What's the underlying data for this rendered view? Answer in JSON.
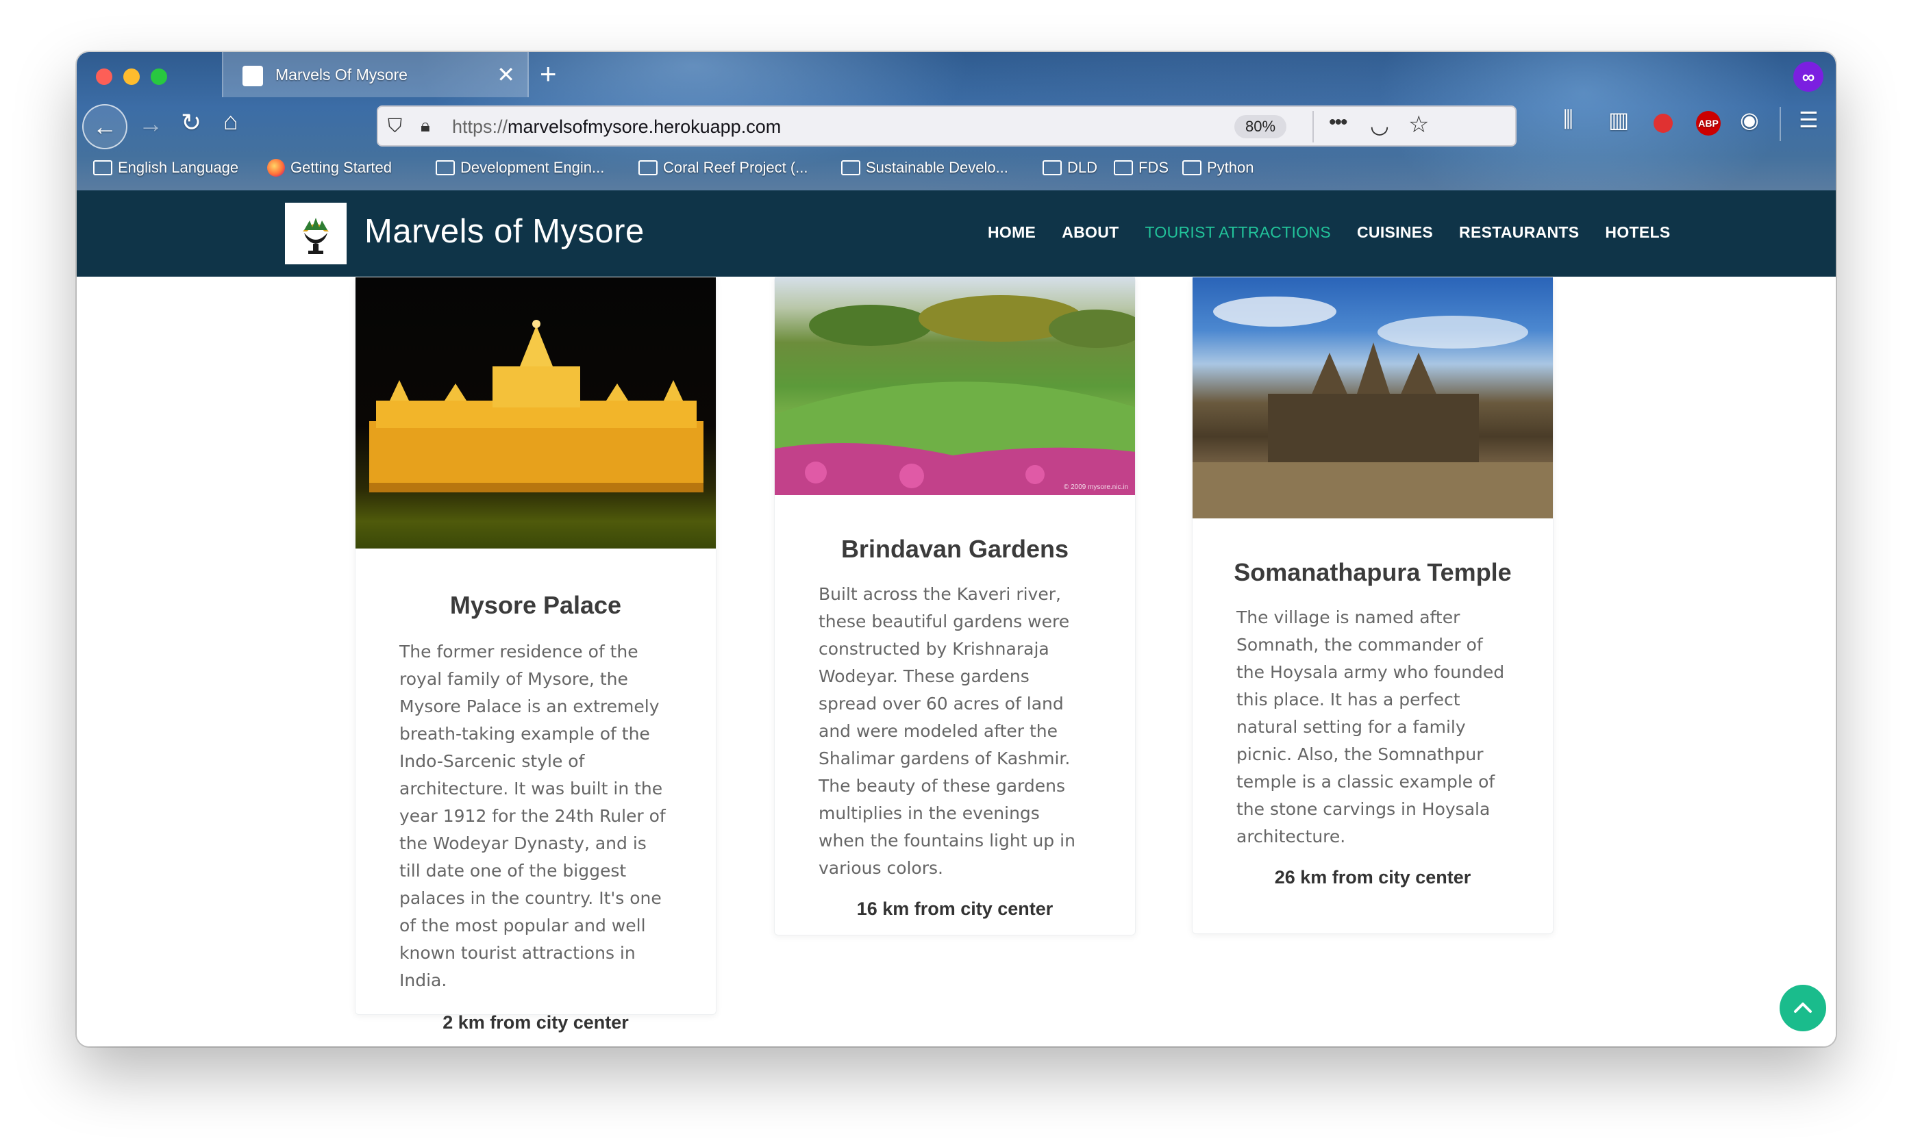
{
  "browser": {
    "tab_title": "Marvels Of Mysore",
    "tab_close": "✕",
    "new_tab": "+",
    "url_protocol": "https://",
    "url_host": "marvelsofmysore.herokuapp.com",
    "zoom": "80%",
    "more_icon": "•••",
    "abp_label": "ABP",
    "bookmarks": [
      {
        "label": "English Language",
        "icon": "folder-icon"
      },
      {
        "label": "Getting Started",
        "icon": "firefox-icon"
      },
      {
        "label": "Development Engin...",
        "icon": "folder-icon"
      },
      {
        "label": "Coral Reef Project (...",
        "icon": "folder-icon"
      },
      {
        "label": "Sustainable Develo...",
        "icon": "folder-icon"
      },
      {
        "label": "DLD",
        "icon": "folder-icon"
      },
      {
        "label": "FDS",
        "icon": "folder-icon"
      },
      {
        "label": "Python",
        "icon": "folder-icon"
      }
    ]
  },
  "site": {
    "title": "Marvels of Mysore",
    "nav": [
      {
        "label": "HOME",
        "active": false
      },
      {
        "label": "ABOUT",
        "active": false
      },
      {
        "label": "TOURIST ATTRACTIONS",
        "active": true
      },
      {
        "label": "CUISINES",
        "active": false
      },
      {
        "label": "RESTAURANTS",
        "active": false
      },
      {
        "label": "HOTELS",
        "active": false
      }
    ],
    "accent_color": "#22c39a",
    "header_color": "#0f3448"
  },
  "cards": [
    {
      "title": "Mysore Palace",
      "description": "The former residence of the royal family of Mysore, the Mysore Palace is an extremely breath-taking example of the Indo-Sarcenic style of architecture. It was built in the year 1912 for the 24th Ruler of the Wodeyar Dynasty, and is till date one of the biggest palaces in the country. It's one of the most popular and well known tourist attractions in India.",
      "distance": "2 km from city center"
    },
    {
      "title": "Brindavan Gardens",
      "description": "Built across the Kaveri river, these beautiful gardens were constructed by Krishnaraja Wodeyar. These gardens spread over 60 acres of land and were modeled after the Shalimar gardens of Kashmir. The beauty of these gardens multiplies in the evenings when the fountains light up in various colors.",
      "distance": "16 km from city center",
      "watermark": "© 2009 mysore.nic.in"
    },
    {
      "title": "Somanathapura Temple",
      "description": "The village is named after Somnath, the commander of the Hoysala army who founded this place. It has a perfect natural setting for a family picnic. Also, the Somnathpur temple is a classic example of the stone carvings in Hoysala architecture.",
      "distance": "26 km from city center"
    }
  ],
  "scroll_top_icon": "chevron-up-icon"
}
